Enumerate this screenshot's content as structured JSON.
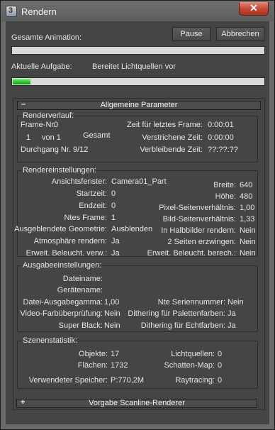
{
  "window": {
    "title": "Rendern"
  },
  "buttons": {
    "pause": "Pause",
    "cancel": "Abbrechen"
  },
  "overall": {
    "label": "Gesamte Animation:",
    "progress": 0.0
  },
  "task": {
    "label": "Aktuelle Aufgabe:",
    "value": "Bereitet Lichtquellen vor",
    "progress": 0.07
  },
  "rollouts": {
    "general": {
      "sign": "–",
      "label": "Allgemeine Parameter"
    },
    "scanline": {
      "sign": "+",
      "label": "Vorgabe Scanline-Renderer"
    }
  },
  "progress_group": {
    "title": "Renderverlauf:",
    "frame_no_label": "Frame-Nr.",
    "frame_no_value": "0",
    "frame_count": "1",
    "frame_of": "von 1",
    "total": "Gesamt",
    "pass": "Durchgang Nr. 9/12",
    "last_frame_label": "Zeit für letztes Frame:",
    "last_frame_value": "0:00:01",
    "elapsed_label": "Verstrichene Zeit:",
    "elapsed_value": "0:00:00",
    "remaining_label": "Verbleibende Zeit:",
    "remaining_value": "??:??:??"
  },
  "render_settings": {
    "title": "Rendereinstellungen:",
    "viewport_label": "Ansichtsfenster:",
    "viewport_value": "Camera01_Part",
    "start_label": "Startzeit:",
    "start_value": "0",
    "end_label": "Endzeit:",
    "end_value": "0",
    "nth_label": "Ntes Frame:",
    "nth_value": "1",
    "hidden_label": "Ausgeblendete Geometrie:",
    "hidden_value": "Ausblenden",
    "atmo_label": "Atmosphäre rendern:",
    "atmo_value": "Ja",
    "adv_use_label": "Erweit. Beleucht. verw.:",
    "adv_use_value": "Ja",
    "width_label": "Breite:",
    "width_value": "640",
    "height_label": "Höhe:",
    "height_value": "480",
    "pixel_aspect_label": "Pixel-Seitenverhältnis:",
    "pixel_aspect_value": "1,00",
    "image_aspect_label": "Bild-Seitenverhältnis:",
    "image_aspect_value": "1,33",
    "halfheight_label": "In Halbbilder rendern:",
    "halfheight_value": "Nein",
    "twosided_label": "2 Seiten erzwingen:",
    "twosided_value": "Nein",
    "adv_compute_label": "Erweit. Beleucht. berech.:",
    "adv_compute_value": "Nein"
  },
  "output_settings": {
    "title": "Ausgabeeinstellungen:",
    "filename_label": "Dateiname:",
    "devicename_label": "Gerätename:",
    "gamma_label": "Datei-Ausgabegamma:",
    "gamma_value": "1,00",
    "video_check_label": "Video-Farbüberprüfung:",
    "video_check_value": "Nein",
    "superblack_label": "Super Black:",
    "superblack_value": "Nein",
    "serial_label": "Nte Seriennummer:",
    "serial_value": "Nein",
    "dither_palette_label": "Dithering für Palettenfarben:",
    "dither_palette_value": "Ja",
    "dither_true_label": "Dithering für Echtfarben:",
    "dither_true_value": "Ja"
  },
  "scene_stats": {
    "title": "Szenenstatistik:",
    "objects_label": "Objekte:",
    "objects_value": "17",
    "faces_label": "Flächen:",
    "faces_value": "1732",
    "memory_label": "Verwendeter Speicher:",
    "memory_value": "P:770,2M",
    "lights_label": "Lichtquellen:",
    "lights_value": "0",
    "shadowmap_label": "Schatten-Map:",
    "shadowmap_value": "0",
    "raytracing_label": "Raytracing:",
    "raytracing_value": "0"
  }
}
